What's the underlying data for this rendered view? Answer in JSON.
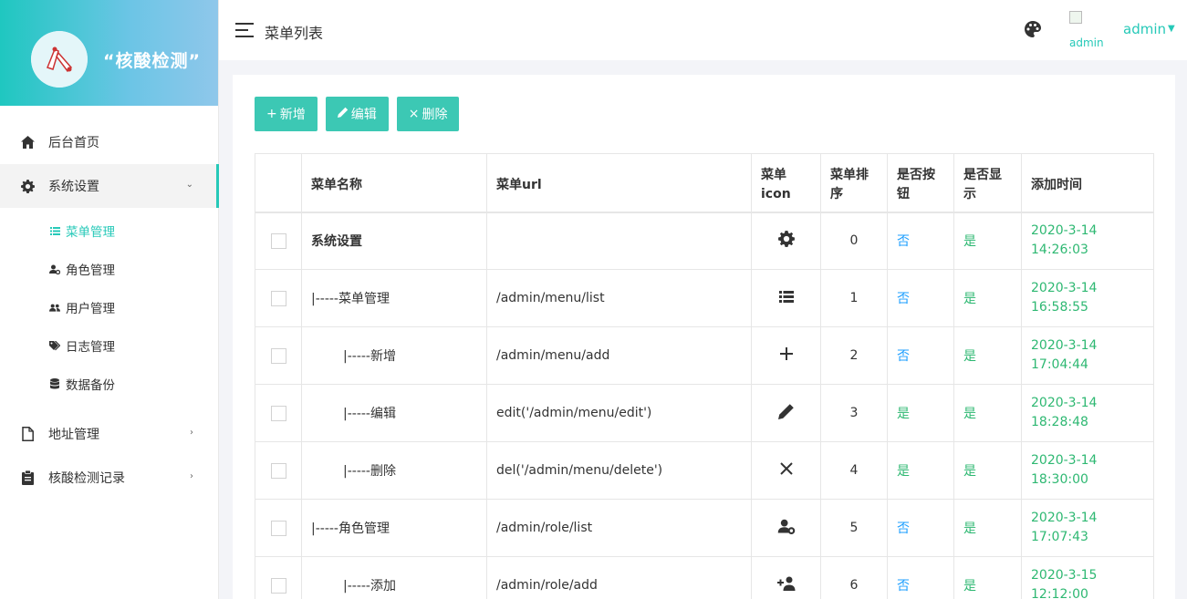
{
  "brand": {
    "title": "“核酸检测”"
  },
  "sidebar": {
    "items": [
      {
        "label": "后台首页",
        "icon": "home-icon"
      },
      {
        "label": "系统设置",
        "icon": "gear-icon",
        "expanded": true,
        "children": [
          {
            "label": "菜单管理",
            "icon": "list-icon",
            "active": true
          },
          {
            "label": "角色管理",
            "icon": "user-gear-icon"
          },
          {
            "label": "用户管理",
            "icon": "users-icon"
          },
          {
            "label": "日志管理",
            "icon": "tag-icon"
          },
          {
            "label": "数据备份",
            "icon": "database-icon"
          }
        ]
      },
      {
        "label": "地址管理",
        "icon": "file-icon"
      },
      {
        "label": "核酸检测记录",
        "icon": "clipboard-icon"
      }
    ]
  },
  "header": {
    "title": "菜单列表",
    "avatar_alt": "admin",
    "user": "admin"
  },
  "toolbar": {
    "add": "新增",
    "edit": "编辑",
    "delete": "删除"
  },
  "table": {
    "columns": [
      "",
      "菜单名称",
      "菜单url",
      "菜单icon",
      "菜单排序",
      "是否按钮",
      "是否显示",
      "添加时间"
    ],
    "rows": [
      {
        "name": "系统设置",
        "url": "",
        "icon": "gear-icon",
        "order": "0",
        "is_button": "否",
        "is_show": "是",
        "date": "2020-3-14",
        "time": "14:26:03"
      },
      {
        "name": "|-----菜单管理",
        "url": "/admin/menu/list",
        "icon": "list-icon",
        "order": "1",
        "is_button": "否",
        "is_show": "是",
        "date": "2020-3-14",
        "time": "16:58:55"
      },
      {
        "name": "|-----新增",
        "url": "/admin/menu/add",
        "icon": "plus-icon",
        "order": "2",
        "is_button": "否",
        "is_show": "是",
        "date": "2020-3-14",
        "time": "17:04:44"
      },
      {
        "name": "|-----编辑",
        "url": "edit('/admin/menu/edit')",
        "icon": "pencil-icon",
        "order": "3",
        "is_button": "是",
        "is_show": "是",
        "date": "2020-3-14",
        "time": "18:28:48"
      },
      {
        "name": "|-----删除",
        "url": "del('/admin/menu/delete')",
        "icon": "close-icon",
        "order": "4",
        "is_button": "是",
        "is_show": "是",
        "date": "2020-3-14",
        "time": "18:30:00"
      },
      {
        "name": "|-----角色管理",
        "url": "/admin/role/list",
        "icon": "user-gear-icon",
        "order": "5",
        "is_button": "否",
        "is_show": "是",
        "date": "2020-3-14",
        "time": "17:07:43"
      },
      {
        "name": "|-----添加",
        "url": "/admin/role/add",
        "icon": "user-plus-icon",
        "order": "6",
        "is_button": "否",
        "is_show": "是",
        "date": "2020-3-15",
        "time": "12:12:00"
      }
    ]
  }
}
